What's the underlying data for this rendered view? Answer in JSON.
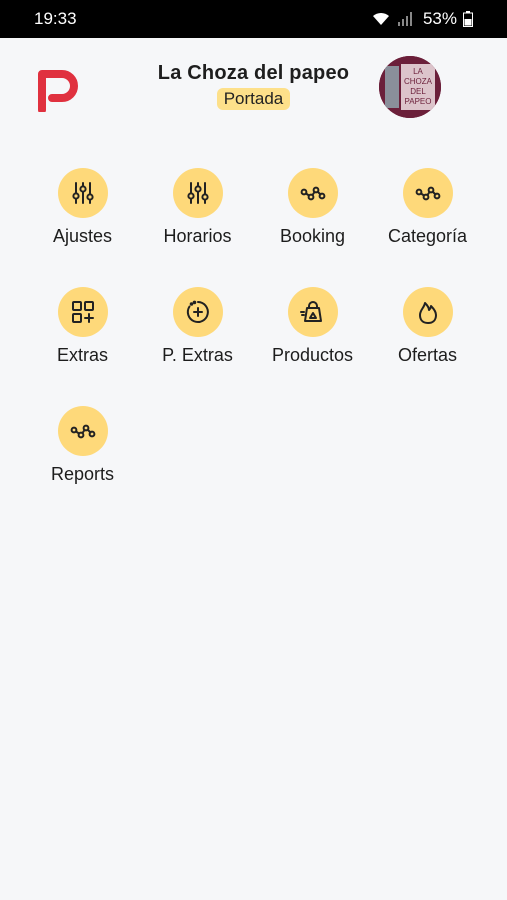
{
  "status_bar": {
    "time": "19:33",
    "battery": "53%"
  },
  "header": {
    "title": "La Choza del papeo",
    "subtitle": "Portada",
    "avatar_text": [
      "LA",
      "CHOZA",
      "DEL",
      "PAPEO"
    ]
  },
  "colors": {
    "accent": "#fed97a",
    "logo": "#e0313f",
    "avatar_bg": "#6b1f3a"
  },
  "menu": [
    {
      "label": "Ajustes",
      "icon": "sliders-icon"
    },
    {
      "label": "Horarios",
      "icon": "sliders-icon"
    },
    {
      "label": "Booking",
      "icon": "nodes-icon"
    },
    {
      "label": "Categoría",
      "icon": "nodes-icon"
    },
    {
      "label": "Extras",
      "icon": "grid-add-icon"
    },
    {
      "label": "P. Extras",
      "icon": "circle-plus-icon"
    },
    {
      "label": "Productos",
      "icon": "bag-icon"
    },
    {
      "label": "Ofertas",
      "icon": "flame-icon"
    },
    {
      "label": "Reports",
      "icon": "nodes-icon"
    }
  ]
}
